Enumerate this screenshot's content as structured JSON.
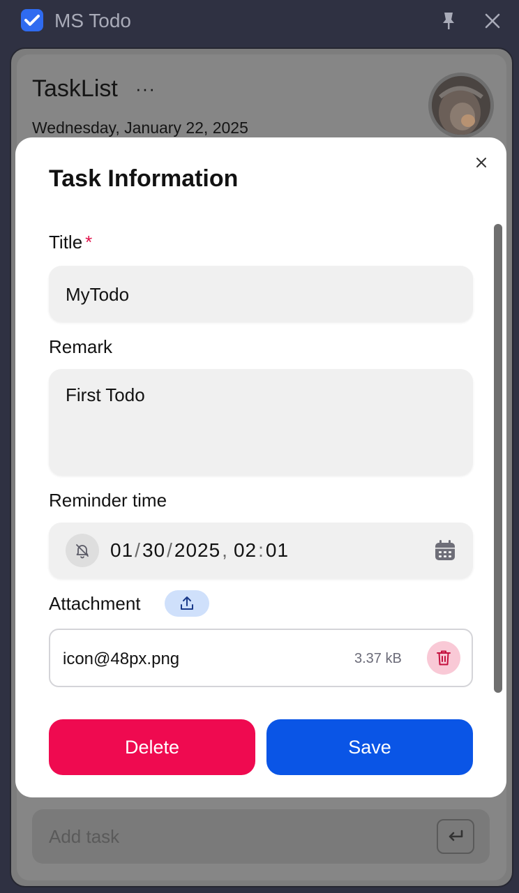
{
  "titlebar": {
    "app_title": "MS Todo",
    "app_icon": "checkbox-icon",
    "pin_icon": "pin-icon",
    "close_icon": "close-icon"
  },
  "background": {
    "list_title": "TaskList",
    "more_label": "···",
    "date": "Wednesday, January 22, 2025",
    "add_task_placeholder": "Add task",
    "enter_icon": "enter-icon"
  },
  "modal": {
    "title": "Task Information",
    "title_field": {
      "label": "Title",
      "required_mark": "*",
      "value": "MyTodo"
    },
    "remark_field": {
      "label": "Remark",
      "value": "First Todo"
    },
    "reminder_field": {
      "label": "Reminder time",
      "month": "01",
      "day": "30",
      "year": "2025",
      "hour": "02",
      "minute": "01",
      "date_sep": "/",
      "date_time_sep": ",",
      "time_sep": ":"
    },
    "attachment": {
      "label": "Attachment",
      "files": [
        {
          "name": "icon@48px.png",
          "size": "3.37 kB"
        }
      ]
    },
    "buttons": {
      "delete_label": "Delete",
      "save_label": "Save"
    }
  },
  "colors": {
    "accent_blue": "#0a55e6",
    "danger_red": "#ef0a50",
    "titlebar_bg": "#2f3142"
  }
}
